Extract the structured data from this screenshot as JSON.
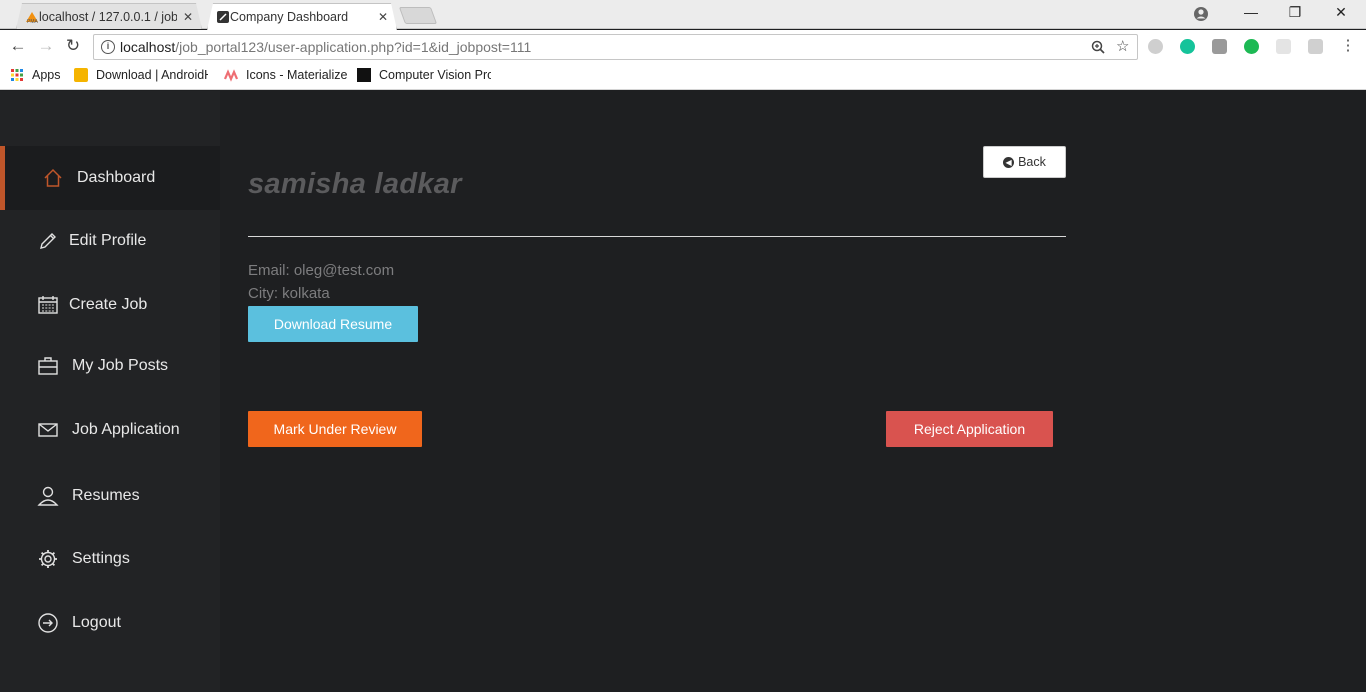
{
  "browser": {
    "tabs": [
      {
        "title": "localhost / 127.0.0.1 / job",
        "close": "✕"
      },
      {
        "title": "Company Dashboard",
        "close": "✕"
      }
    ],
    "window_controls": {
      "minimize": "—",
      "restore": "❐",
      "close": "✕"
    },
    "address": {
      "host": "localhost",
      "path": "/job_portal123/user-application.php?id=1&id_jobpost=111"
    },
    "bookmarks": [
      "Apps",
      "Download | AndroidH",
      "Icons - Materialize",
      "Computer Vision Proj"
    ]
  },
  "sidebar": {
    "items": [
      {
        "label": "Dashboard",
        "icon": "home-icon",
        "active": true
      },
      {
        "label": "Edit Profile",
        "icon": "pencil-icon"
      },
      {
        "label": "Create Job",
        "icon": "calendar-icon"
      },
      {
        "label": "My Job Posts",
        "icon": "briefcase-icon"
      },
      {
        "label": "Job Application",
        "icon": "envelope-icon"
      },
      {
        "label": "Resumes",
        "icon": "user-icon"
      },
      {
        "label": "Settings",
        "icon": "gear-icon"
      },
      {
        "label": "Logout",
        "icon": "logout-icon"
      }
    ],
    "accent": "#c0562a"
  },
  "applicant": {
    "name": "samisha ladkar",
    "email": "Email: oleg@test.com",
    "city": "City: kolkata"
  },
  "actions": {
    "back": "Back",
    "download_resume": "Download Resume",
    "mark_review": "Mark Under Review",
    "reject": "Reject Application"
  },
  "colors": {
    "resume_button": "#5bc0de",
    "review_button": "#f0661c",
    "reject_button": "#d9534f"
  }
}
